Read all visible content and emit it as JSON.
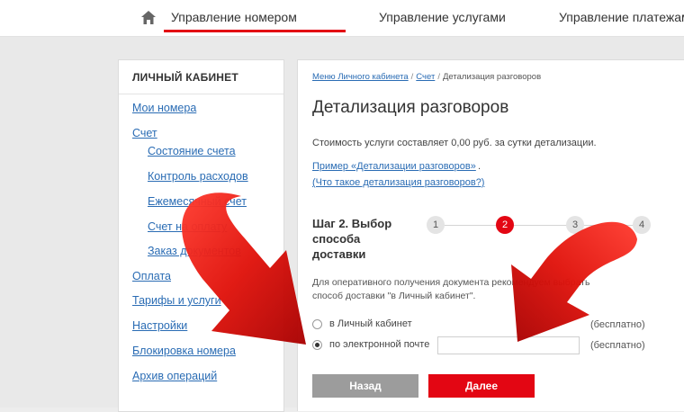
{
  "top_nav": {
    "home_icon": "home-icon",
    "tabs": [
      {
        "label": "Управление номером",
        "active": true
      },
      {
        "label": "Управление услугами",
        "active": false
      },
      {
        "label": "Управление платежами",
        "active": false
      }
    ]
  },
  "sidebar": {
    "title": "ЛИЧНЫЙ КАБИНЕТ",
    "items": [
      {
        "label": "Мои номера",
        "level": 0
      },
      {
        "label": "Счет",
        "level": 0
      },
      {
        "label": "Состояние счета",
        "level": 1
      },
      {
        "label": "Контроль расходов",
        "level": 1
      },
      {
        "label": "Ежемесячный счет",
        "level": 1
      },
      {
        "label": "Счет на оплату",
        "level": 1
      },
      {
        "label": "Заказ документов",
        "level": 1
      },
      {
        "label": "Оплата",
        "level": 0
      },
      {
        "label": "Тарифы и услуги",
        "level": 0
      },
      {
        "label": "Настройки",
        "level": 0
      },
      {
        "label": "Блокировка номера",
        "level": 0
      },
      {
        "label": "Архив операций",
        "level": 0
      }
    ]
  },
  "main": {
    "breadcrumb": {
      "items": [
        "Меню Личного кабинета",
        "Счет"
      ],
      "current": "Детализация разговоров"
    },
    "title": "Детализация разговоров",
    "cost_text": "Стоимость услуги составляет 0,00 руб. за сутки детализации.",
    "example_link": "Пример «Детализации разговоров»",
    "example_suffix": ".",
    "what_link": "(Что такое детализация разговоров?)",
    "step_title": "Шаг 2. Выбор способа доставки",
    "steps": [
      "1",
      "2",
      "3",
      "4"
    ],
    "active_step": 2,
    "description": "Для оперативного получения документа рекомендуем выбрать способ доставки \"в Личный кабинет\".",
    "options": [
      {
        "label": "в Личный кабинет",
        "price": "(бесплатно)",
        "selected": false
      },
      {
        "label": "по электронной почте",
        "price": "(бесплатно)",
        "selected": true
      }
    ],
    "email_value": "",
    "back_button": "Назад",
    "next_button": "Далее"
  },
  "colors": {
    "accent": "#e30613",
    "link": "#2a6cb4",
    "button_gray": "#9c9c9c"
  }
}
